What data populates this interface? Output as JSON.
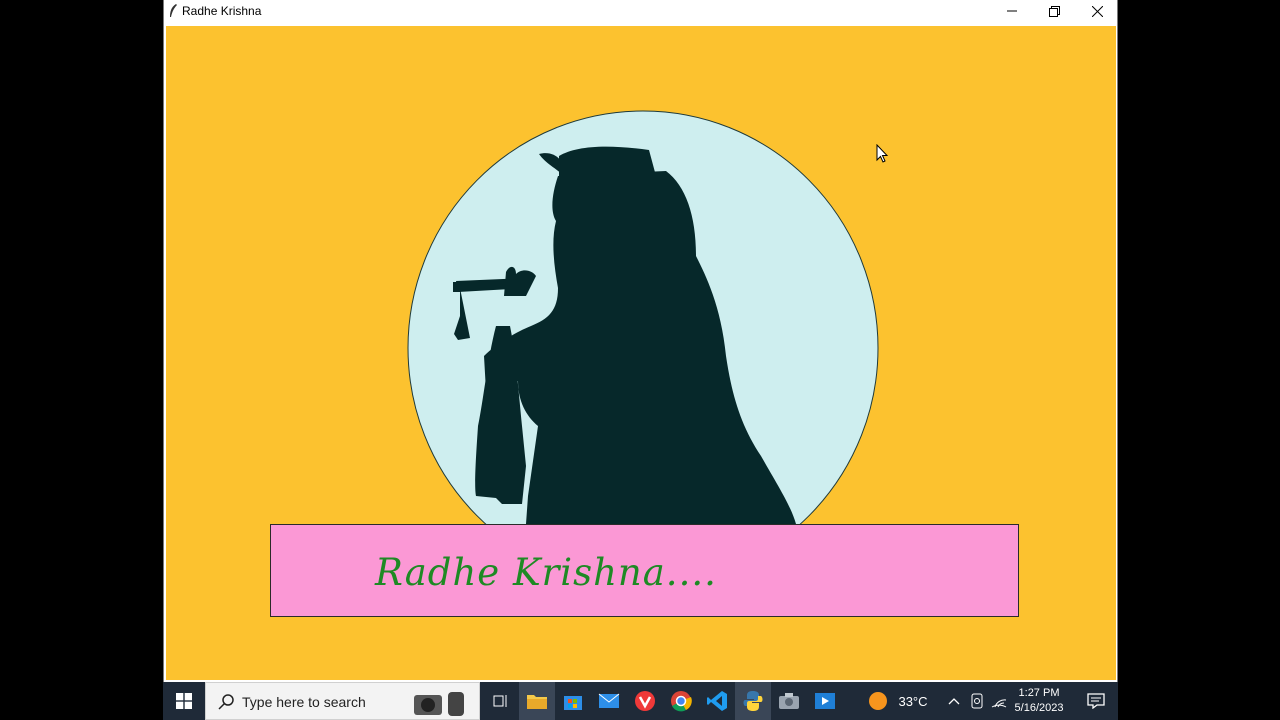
{
  "window": {
    "title": "Radhe Krishna"
  },
  "canvas": {
    "background": "#fcc22f",
    "moon_color": "#ceeeef",
    "silhouette_color": "#06282a",
    "banner_color": "#fb98d5",
    "banner_text": "Radhe Krishna....",
    "banner_text_color": "#1e8a24"
  },
  "taskbar": {
    "search_placeholder": "Type here to search",
    "weather": "33°C",
    "time": "1:27 PM",
    "date": "5/16/2023",
    "icons": [
      "windows-start-icon",
      "search-icon",
      "camera-icon",
      "task-view-icon",
      "file-explorer-icon",
      "store-icon",
      "mail-icon",
      "vivaldi-icon",
      "chrome-icon",
      "vscode-icon",
      "python-icon",
      "photos-icon",
      "media-player-icon",
      "weather-sun-icon",
      "chevron-up-icon",
      "meet-now-icon",
      "wifi-icon",
      "notification-icon"
    ]
  }
}
